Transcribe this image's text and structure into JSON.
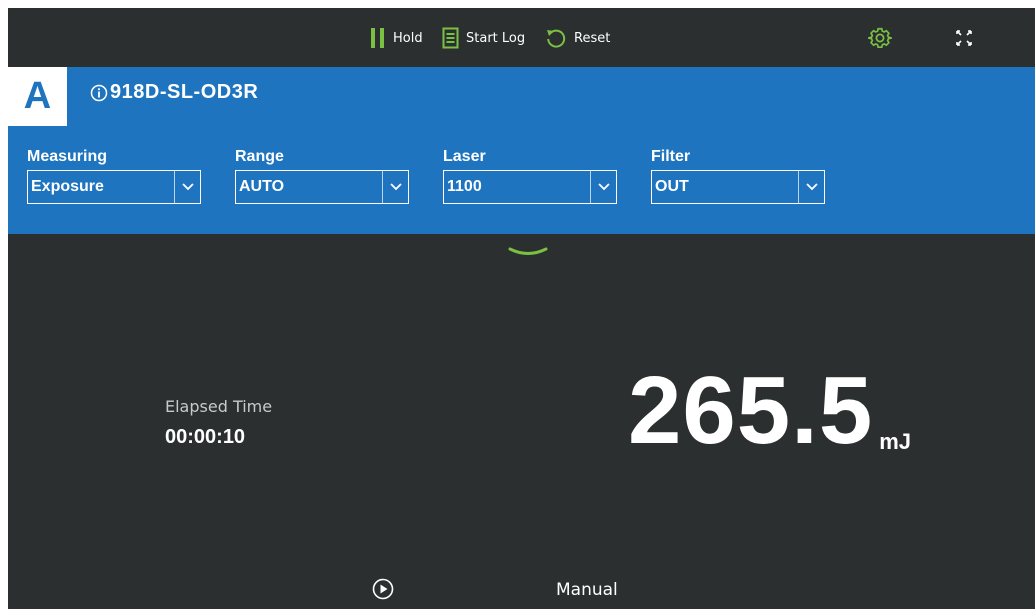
{
  "toolbar": {
    "hold_label": "Hold",
    "start_log_label": "Start Log",
    "reset_label": "Reset",
    "hold_icon": "pause-icon",
    "start_log_icon": "log-icon",
    "reset_icon": "reset-icon",
    "settings_icon": "gear-icon",
    "fullscreen_icon": "fullscreen-icon"
  },
  "header": {
    "channel": "A",
    "device_name": "918D-SL-OD3R"
  },
  "controls": {
    "measuring": {
      "label": "Measuring",
      "value": "Exposure"
    },
    "range": {
      "label": "Range",
      "value": "AUTO"
    },
    "laser": {
      "label": "Laser",
      "value": "1100"
    },
    "filter": {
      "label": "Filter",
      "value": "OUT"
    }
  },
  "readout": {
    "elapsed_label": "Elapsed Time",
    "elapsed_value": "00:00:10",
    "value": "265.5",
    "unit": "mJ"
  },
  "footer": {
    "mode_label": "Manual"
  },
  "colors": {
    "background": "#2b2f30",
    "header_blue": "#1f74c0",
    "accent_green": "#7ac143",
    "text_white": "#ffffff"
  }
}
